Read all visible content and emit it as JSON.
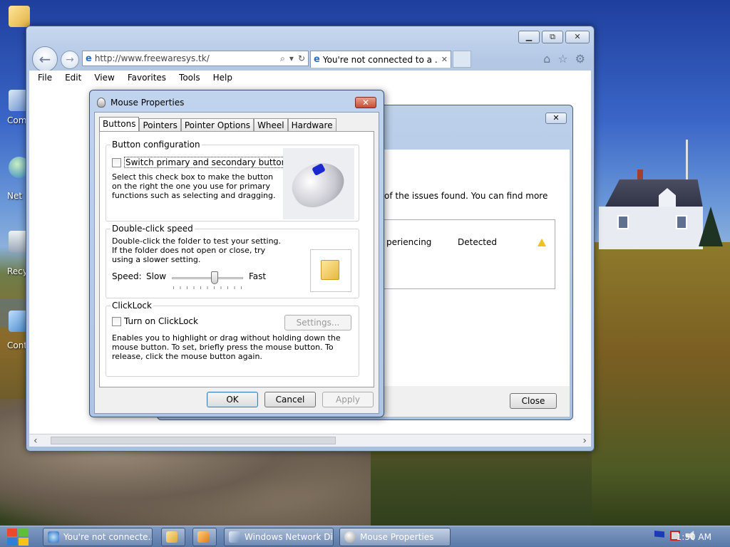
{
  "desktop": {
    "icons": [
      {
        "label": "Com"
      },
      {
        "label": "Net"
      },
      {
        "label": "Recy"
      },
      {
        "label": "Contro"
      }
    ]
  },
  "ie": {
    "address": "http://www.freewaresys.tk/",
    "tab_title": "You're not connected to a ...",
    "menu": [
      "File",
      "Edit",
      "View",
      "Favorites",
      "Tools",
      "Help"
    ]
  },
  "netdiag": {
    "partial_text": "of the issues found. You can find more",
    "issue_name": "periencing",
    "issue_status": "Detected",
    "close_label": "Close"
  },
  "mouse_properties": {
    "title": "Mouse Properties",
    "tabs": [
      "Buttons",
      "Pointers",
      "Pointer Options",
      "Wheel",
      "Hardware"
    ],
    "active_tab": "Buttons",
    "button_config": {
      "title": "Button configuration",
      "checkbox_label": "Switch primary and secondary buttons",
      "checked": false,
      "description": "Select this check box to make the button on the right the one you use for primary functions such as selecting and dragging."
    },
    "double_click": {
      "title": "Double-click speed",
      "description": "Double-click the folder to test your setting. If the folder does not open or close, try using a slower setting.",
      "speed_label": "Speed:",
      "slow_label": "Slow",
      "fast_label": "Fast",
      "slider_value": 0.6
    },
    "clicklock": {
      "title": "ClickLock",
      "checkbox_label": "Turn on ClickLock",
      "checked": false,
      "settings_label": "Settings...",
      "description": "Enables you to highlight or drag without holding down the mouse button. To set, briefly press the mouse button. To release, click the mouse button again."
    },
    "buttons": {
      "ok": "OK",
      "cancel": "Cancel",
      "apply": "Apply"
    }
  },
  "taskbar": {
    "items": [
      {
        "label": "You're not connecte..."
      },
      {
        "label": "Windows Network Di..."
      },
      {
        "label": "Mouse Properties"
      }
    ],
    "clock": "1:50 AM"
  }
}
